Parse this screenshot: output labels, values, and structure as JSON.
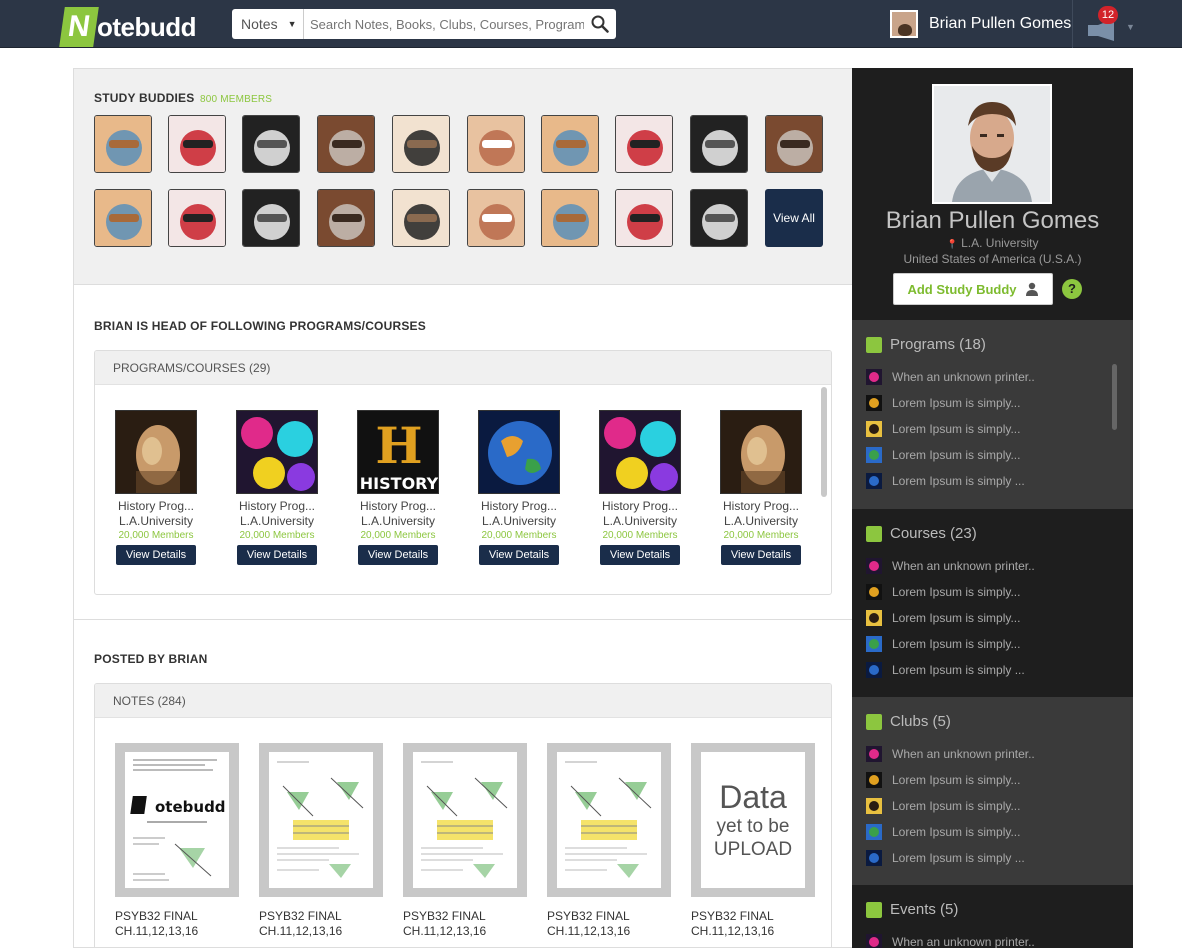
{
  "header": {
    "logo_initial": "N",
    "logo_rest": "otebudd",
    "search_category": "Notes",
    "search_placeholder": "Search Notes, Books, Clubs, Courses, Programs",
    "user_name": "Brian Pullen Gomes",
    "notification_count": "12"
  },
  "study_buddies": {
    "title": "STUDY BUDDIES",
    "members": "800 MEMBERS",
    "view_all": "View All"
  },
  "programs_section": {
    "title": "BRIAN IS HEAD OF FOLLOWING PROGRAMS/COURSES",
    "box_label": "PROGRAMS/COURSES (29)",
    "cards": [
      {
        "name": "History Prog...",
        "uni": "L.A.University",
        "members": "20,000 Members",
        "button": "View Details",
        "thumb": "sculpture"
      },
      {
        "name": "History Prog...",
        "uni": "L.A.University",
        "members": "20,000 Members",
        "button": "View Details",
        "thumb": "colorful"
      },
      {
        "name": "History Prog...",
        "uni": "L.A.University",
        "members": "20,000 Members",
        "button": "View Details",
        "thumb": "history"
      },
      {
        "name": "History Prog...",
        "uni": "L.A.University",
        "members": "20,000 Members",
        "button": "View Details",
        "thumb": "globe"
      },
      {
        "name": "History Prog...",
        "uni": "L.A.University",
        "members": "20,000 Members",
        "button": "View Details",
        "thumb": "colorful"
      },
      {
        "name": "History Prog...",
        "uni": "L.A.University",
        "members": "20,000 Members",
        "button": "View Details",
        "thumb": "sculpture"
      }
    ],
    "history_logo_letter": "H",
    "history_logo_word": "HISTORY"
  },
  "posted_section": {
    "title": "POSTED BY BRIAN",
    "box_label": "NOTES (284)",
    "notes": [
      {
        "line1": "PSYB32 FINAL",
        "line2": "CH.11,12,13,16",
        "kind": "logo"
      },
      {
        "line1": "PSYB32 FINAL",
        "line2": "CH.11,12,13,16",
        "kind": "doc"
      },
      {
        "line1": "PSYB32 FINAL",
        "line2": "CH.11,12,13,16",
        "kind": "doc"
      },
      {
        "line1": "PSYB32 FINAL",
        "line2": "CH.11,12,13,16",
        "kind": "doc"
      },
      {
        "line1": "PSYB32 FINAL",
        "line2": "CH.11,12,13,16",
        "kind": "upload"
      }
    ],
    "note_logo_text": "notebudd",
    "upload_line1": "Data",
    "upload_line2": "yet to be",
    "upload_line3": "UPLOAD"
  },
  "profile": {
    "name": "Brian Pullen Gomes",
    "university": "L.A. University",
    "country": "United States of America (U.S.A.)",
    "add_button": "Add Study Buddy",
    "help_label": "?"
  },
  "groups": [
    {
      "title": "Programs (18)",
      "items": [
        "When an unknown printer..",
        "Lorem Ipsum is simply...",
        "Lorem Ipsum is simply...",
        "Lorem Ipsum is simply...",
        "Lorem Ipsum is simply ..."
      ]
    },
    {
      "title": "Courses (23)",
      "items": [
        "When an unknown printer..",
        "Lorem Ipsum is simply...",
        "Lorem Ipsum is simply...",
        "Lorem Ipsum is simply...",
        "Lorem Ipsum is simply ..."
      ]
    },
    {
      "title": "Clubs (5)",
      "items": [
        "When an unknown printer..",
        "Lorem Ipsum is simply...",
        "Lorem Ipsum is simply...",
        "Lorem Ipsum is simply...",
        "Lorem Ipsum is simply ..."
      ]
    },
    {
      "title": "Events (5)",
      "items": [
        "When an unknown printer.."
      ]
    }
  ],
  "colors": {
    "brand_green": "#8cc63f",
    "navy": "#1a2d4a",
    "topbar": "#2c3646",
    "badge_red": "#d2232a"
  }
}
